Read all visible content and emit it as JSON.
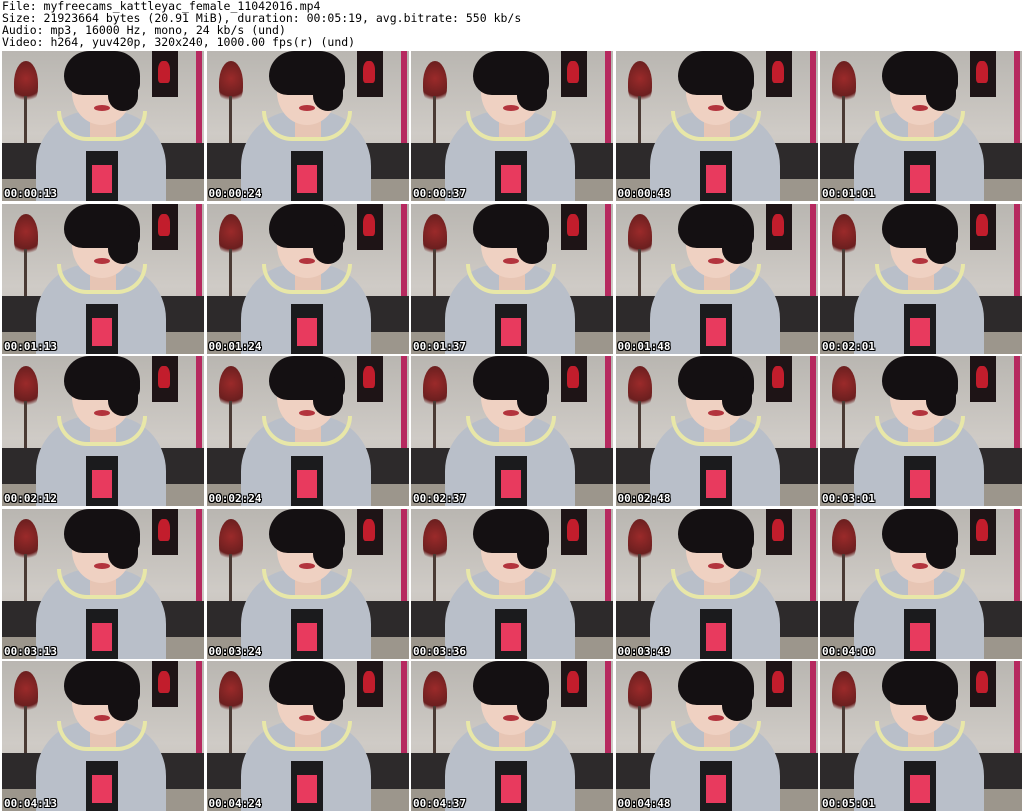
{
  "header": {
    "file_line": "File: myfreecams_kattleyac_female_11042016.mp4",
    "size_line": "Size: 21923664 bytes (20.91 MiB), duration: 00:05:19, avg.bitrate: 550 kb/s",
    "audio_line": "Audio: mp3, 16000 Hz, mono, 24 kb/s (und)",
    "video_line": "Video: h264, yuv420p, 320x240, 1000.00 fps(r) (und)"
  },
  "thumbnails": [
    {
      "timestamp": "00:00:13"
    },
    {
      "timestamp": "00:00:24"
    },
    {
      "timestamp": "00:00:37"
    },
    {
      "timestamp": "00:00:48"
    },
    {
      "timestamp": "00:01:01"
    },
    {
      "timestamp": "00:01:13"
    },
    {
      "timestamp": "00:01:24"
    },
    {
      "timestamp": "00:01:37"
    },
    {
      "timestamp": "00:01:48"
    },
    {
      "timestamp": "00:02:01"
    },
    {
      "timestamp": "00:02:12"
    },
    {
      "timestamp": "00:02:24"
    },
    {
      "timestamp": "00:02:37"
    },
    {
      "timestamp": "00:02:48"
    },
    {
      "timestamp": "00:03:01"
    },
    {
      "timestamp": "00:03:13"
    },
    {
      "timestamp": "00:03:24"
    },
    {
      "timestamp": "00:03:36"
    },
    {
      "timestamp": "00:03:49"
    },
    {
      "timestamp": "00:04:00"
    },
    {
      "timestamp": "00:04:13"
    },
    {
      "timestamp": "00:04:24"
    },
    {
      "timestamp": "00:04:37"
    },
    {
      "timestamp": "00:04:48"
    },
    {
      "timestamp": "00:05:01"
    }
  ]
}
